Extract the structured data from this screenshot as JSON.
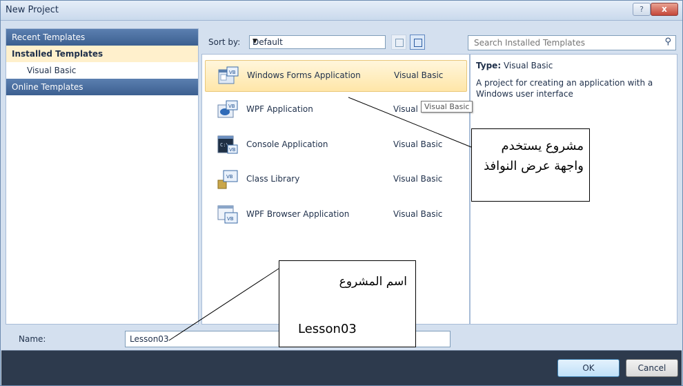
{
  "window": {
    "title": "New Project",
    "help_icon": "?",
    "close_icon": "x"
  },
  "sidebar": {
    "items": [
      {
        "label": "Recent Templates"
      },
      {
        "label": "Installed Templates"
      },
      {
        "label": "Visual Basic"
      },
      {
        "label": "Online Templates"
      }
    ]
  },
  "toolbar": {
    "sort_label": "Sort by:",
    "sort_value": "Default"
  },
  "search": {
    "placeholder": "Search Installed Templates",
    "icon": "search-icon"
  },
  "templates": [
    {
      "name": "Windows Forms Application",
      "language": "Visual Basic",
      "selected": true,
      "icon": "windows-forms-icon"
    },
    {
      "name": "WPF Application",
      "language": "Visual",
      "selected": false,
      "icon": "wpf-icon"
    },
    {
      "name": "Console Application",
      "language": "Visual Basic",
      "selected": false,
      "icon": "console-icon"
    },
    {
      "name": "Class Library",
      "language": "Visual Basic",
      "selected": false,
      "icon": "class-library-icon"
    },
    {
      "name": "WPF Browser Application",
      "language": "Visual Basic",
      "selected": false,
      "icon": "wpf-browser-icon"
    }
  ],
  "tooltip": "Visual Basic",
  "details": {
    "type_label": "Type:",
    "type_value": "Visual Basic",
    "description": "A project for creating an application with a Windows user interface"
  },
  "name_field": {
    "label": "Name:",
    "value": "Lesson03"
  },
  "buttons": {
    "ok": "OK",
    "cancel": "Cancel"
  },
  "callouts": {
    "top": "مشروع يستخدم واجهة عرض النوافذ",
    "bottom_arabic": "اسم المشروع",
    "bottom_english": "Lesson03"
  },
  "colors": {
    "accent": "#3c5f90",
    "selection": "#ffe6a8",
    "footer": "#2d3a4d"
  }
}
